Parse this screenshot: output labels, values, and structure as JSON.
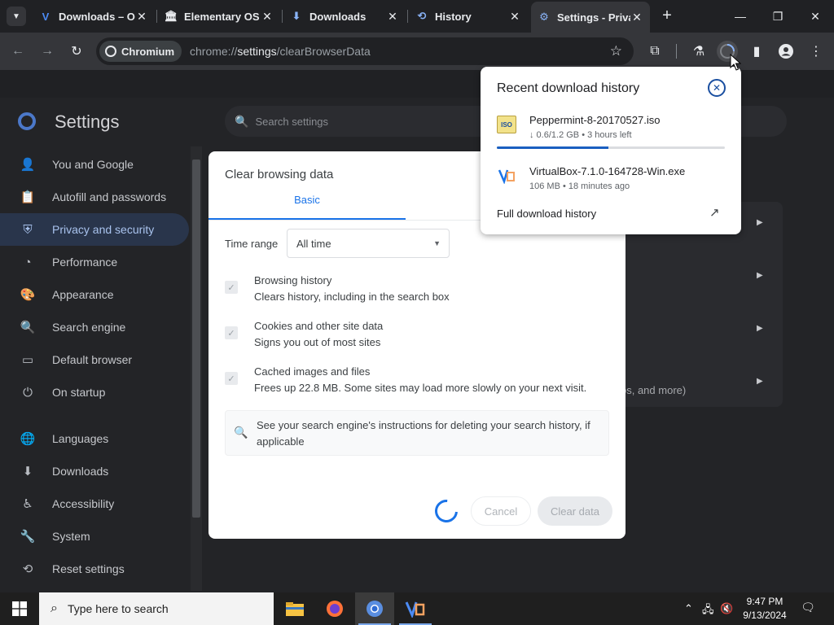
{
  "browser": {
    "tabs": [
      {
        "title": "Downloads – O",
        "icon": "virtualbox-icon"
      },
      {
        "title": "Elementary OS",
        "icon": "institution-icon"
      },
      {
        "title": "Downloads",
        "icon": "download-arrow-icon"
      },
      {
        "title": "History",
        "icon": "history-icon"
      },
      {
        "title": "Settings - Priva",
        "icon": "gear-icon"
      }
    ],
    "active_tab": 4,
    "chip_label": "Chromium",
    "url_host": "chrome://",
    "url_path_strong": "settings",
    "url_path_rest": "/clearBrowserData"
  },
  "settings": {
    "title": "Settings",
    "search_placeholder": "Search settings",
    "nav": [
      {
        "label": "You and Google",
        "icon": "person-icon"
      },
      {
        "label": "Autofill and passwords",
        "icon": "clipboard-icon"
      },
      {
        "label": "Privacy and security",
        "icon": "shield-icon",
        "active": true
      },
      {
        "label": "Performance",
        "icon": "speedometer-icon"
      },
      {
        "label": "Appearance",
        "icon": "palette-icon"
      },
      {
        "label": "Search engine",
        "icon": "search-icon"
      },
      {
        "label": "Default browser",
        "icon": "browser-window-icon"
      },
      {
        "label": "On startup",
        "icon": "power-icon"
      },
      {
        "label": "Languages",
        "icon": "globe-icon"
      },
      {
        "label": "Downloads",
        "icon": "download-icon"
      },
      {
        "label": "Accessibility",
        "icon": "accessibility-icon"
      },
      {
        "label": "System",
        "icon": "wrench-icon"
      },
      {
        "label": "Reset settings",
        "icon": "reset-icon"
      }
    ],
    "card_text": "os, and more)"
  },
  "dialog": {
    "title": "Clear browsing data",
    "tab_basic": "Basic",
    "time_range_label": "Time range",
    "time_range_value": "All time",
    "options": [
      {
        "title": "Browsing history",
        "subtitle": "Clears history, including in the search box",
        "checked": true
      },
      {
        "title": "Cookies and other site data",
        "subtitle": "Signs you out of most sites",
        "checked": true
      },
      {
        "title": "Cached images and files",
        "subtitle": "Frees up 22.8 MB. Some sites may load more slowly on your next visit.",
        "checked": true
      }
    ],
    "info_text": "See your search engine's instructions for deleting your search history, if applicable",
    "cancel_label": "Cancel",
    "clear_label": "Clear data"
  },
  "downloads_bubble": {
    "title": "Recent download history",
    "items": [
      {
        "name": "Peppermint-8-20170527.iso",
        "meta": "↓ 0.6/1.2 GB • 3 hours left",
        "icon": "iso-file-icon",
        "progress": 0.49
      },
      {
        "name": "VirtualBox-7.1.0-164728-Win.exe",
        "meta": "106 MB • 18 minutes ago",
        "icon": "virtualbox-icon"
      }
    ],
    "iso_icon_text": "ISO",
    "full_history_label": "Full download history"
  },
  "taskbar": {
    "search_placeholder": "Type here to search",
    "time": "9:47 PM",
    "date": "9/13/2024"
  }
}
